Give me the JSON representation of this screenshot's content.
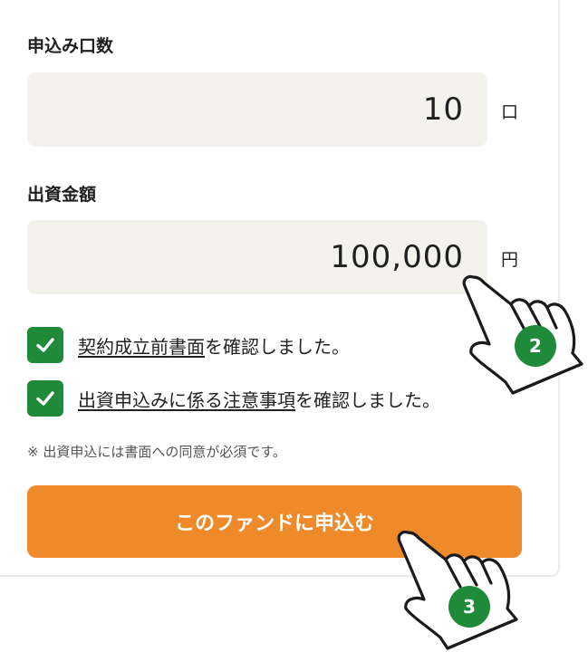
{
  "form": {
    "units": {
      "label": "申込み口数",
      "value": "10",
      "unit": "口"
    },
    "amount": {
      "label": "出資金額",
      "value": "100,000",
      "unit": "円"
    },
    "checks": [
      {
        "checked": true,
        "link_text": "契約成立前書面",
        "suffix_text": "を確認しました。"
      },
      {
        "checked": true,
        "link_text": "出資申込みに係る注意事項",
        "suffix_text": "を確認しました。"
      }
    ],
    "note": "※ 出資申込には書面への同意が必須です。",
    "submit_label": "このファンドに申込む"
  },
  "annotations": {
    "step_two": "2",
    "step_three": "3"
  },
  "colors": {
    "accent_green": "#1f8a3a",
    "button_orange": "#ef8a2a",
    "input_background": "#f3f2ec"
  }
}
